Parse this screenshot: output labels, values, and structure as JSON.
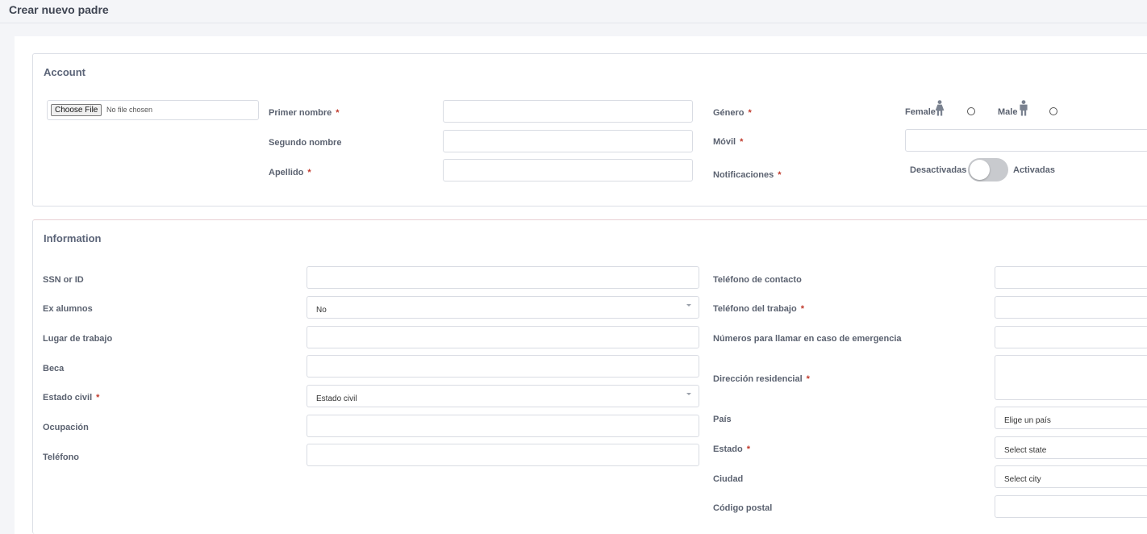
{
  "page": {
    "title": "Crear nuevo padre"
  },
  "account": {
    "title": "Account",
    "file": {
      "button": "Choose File",
      "status": "No file chosen"
    },
    "first_name_label": "Primer nombre",
    "middle_name_label": "Segundo nombre",
    "last_name_label": "Apellido",
    "gender_label": "Género",
    "gender_options": {
      "female": "Female",
      "male": "Male"
    },
    "mobile_label": "Móvil",
    "notifications_label": "Notificaciones",
    "notifications_off": "Desactivadas",
    "notifications_on": "Activadas",
    "required_mark": "*"
  },
  "information": {
    "title": "Information",
    "ssn_label": "SSN or ID",
    "alumni_label": "Ex alumnos",
    "alumni_value": "No",
    "workplace_label": "Lugar de trabajo",
    "scholarship_label": "Beca",
    "marital_label": "Estado civil",
    "marital_value": "Estado civil",
    "occupation_label": "Ocupación",
    "phone_label": "Teléfono",
    "contact_phone_label": "Teléfono de contacto",
    "work_phone_label": "Teléfono del trabajo",
    "emergency_label": "Números para llamar en caso de emergencia",
    "address_label": "Dirección residencial",
    "country_label": "País",
    "country_value": "Elige un país",
    "state_label": "Estado",
    "state_value": "Select state",
    "city_label": "Ciudad",
    "city_value": "Select city",
    "zip_label": "Código postal",
    "required_mark": "*"
  },
  "icons": {
    "female": "female-person-icon",
    "male": "male-person-icon"
  },
  "colors": {
    "required": "#c0392b",
    "icon": "#7a8290",
    "toggle_off": "#c8cace"
  }
}
